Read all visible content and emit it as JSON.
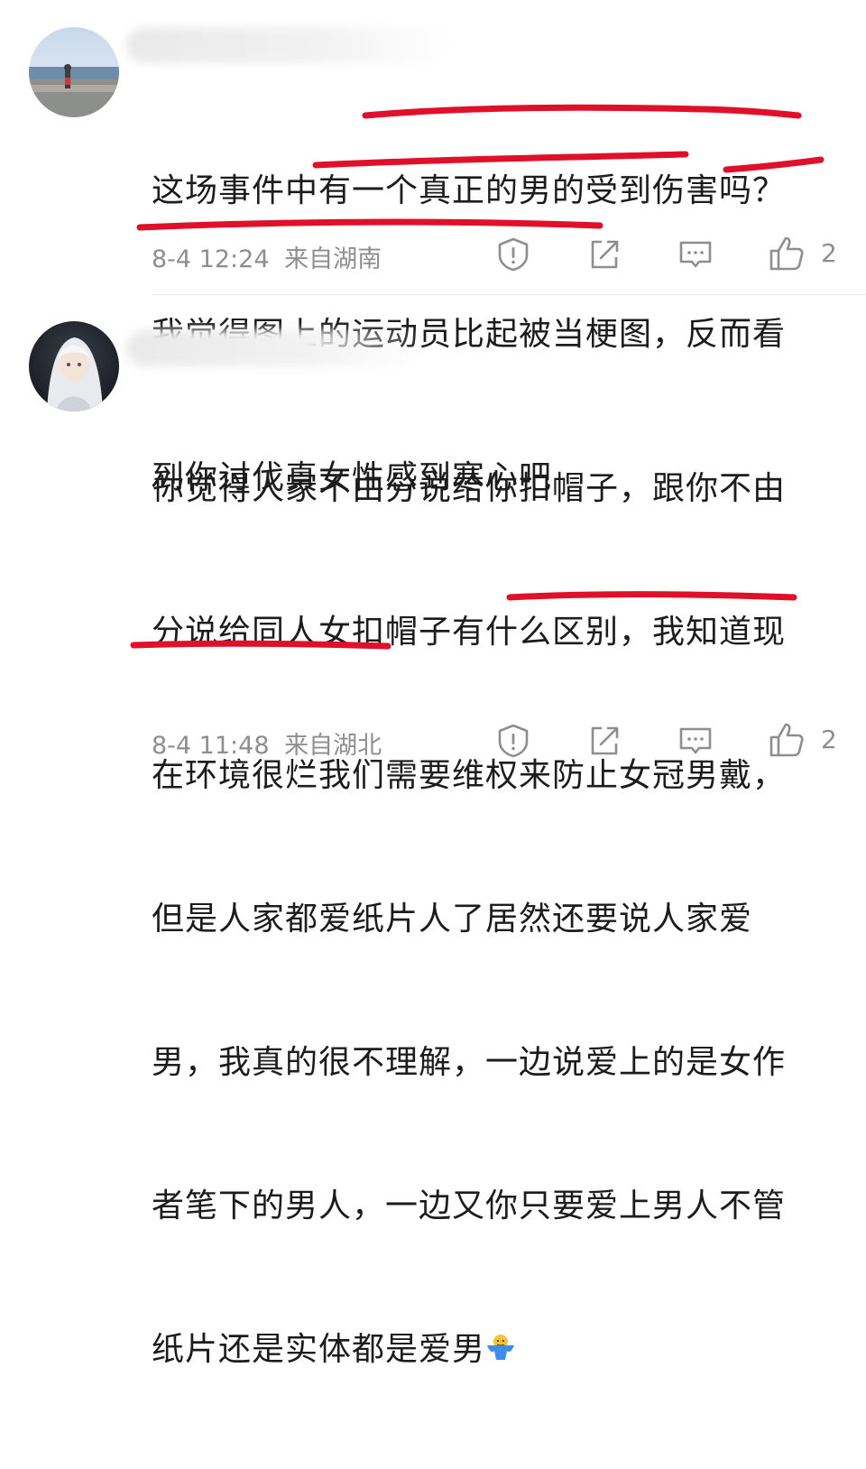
{
  "comments": [
    {
      "avatar": "beach-photo-avatar",
      "lines": [
        "这场事件中有一个真正的男的受到伤害吗？",
        "我觉得图上的运动员比起被当梗图，反而看",
        "到你讨伐真女性感到寒心吧"
      ],
      "time": "8-4 12:24",
      "location": "来自湖南",
      "likes": "2"
    },
    {
      "avatar": "anime-character-avatar",
      "lines": [
        "你觉得人家不由分说给你扣帽子，跟你不由",
        "分说给同人女扣帽子有什么区别，我知道现",
        "在环境很烂我们需要维权来防止女冠男戴，",
        "但是人家都爱纸片人了居然还要说人家爱",
        "男，我真的很不理解，一边说爱上的是女作",
        "者笔下的男人，一边又你只要爱上男人不管",
        "纸片还是实体都是爱男"
      ],
      "emoji": "shrug-emoji",
      "time": "8-4 11:48",
      "location": "来自湖北",
      "likes": "2"
    }
  ],
  "colors": {
    "underline": "#e0102a",
    "meta_text": "#8e8e8e",
    "body_text": "#1c1c1c"
  },
  "icons": [
    "report-icon",
    "share-icon",
    "reply-icon",
    "like-icon"
  ]
}
